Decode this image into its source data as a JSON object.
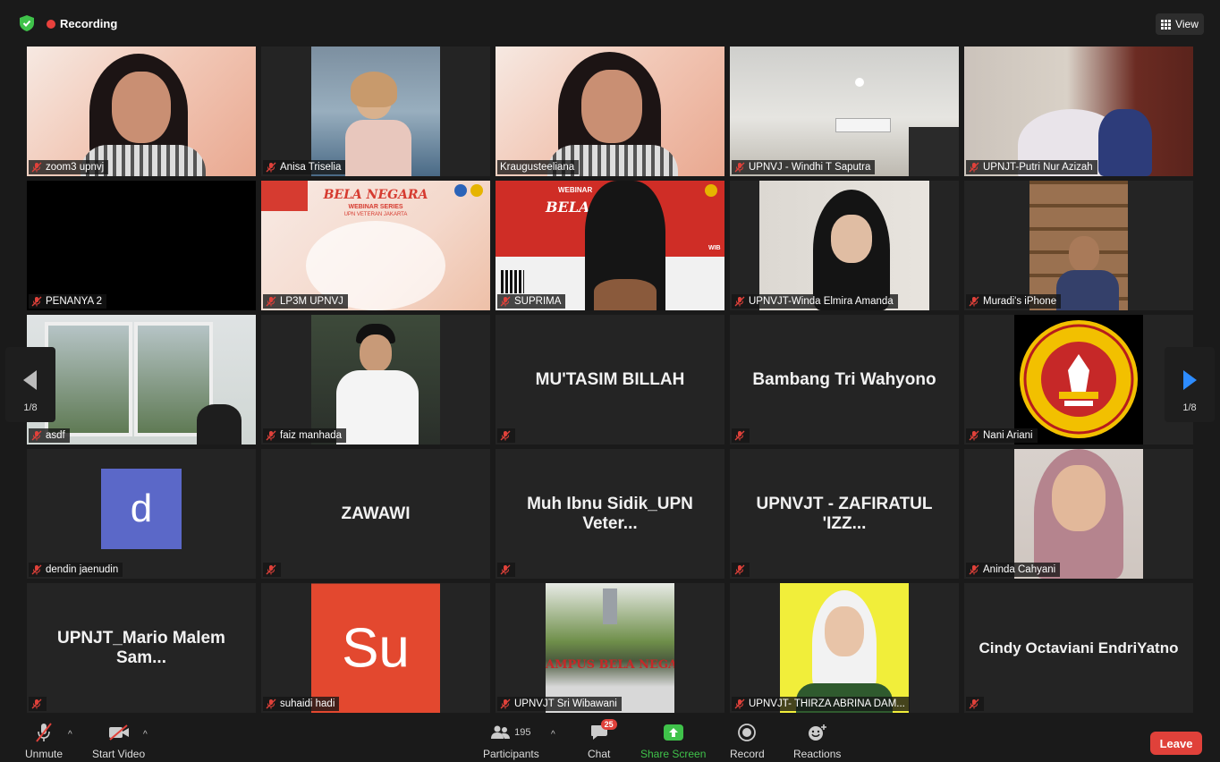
{
  "recording_label": "Recording",
  "view_label": "View",
  "page_indicator": {
    "left": "1/8",
    "right": "1/8"
  },
  "tiles": [
    {
      "name": "zoom3 upnvj"
    },
    {
      "name": "Anisa Triselia"
    },
    {
      "name": "Kraugusteeliana"
    },
    {
      "name": "UPNVJ - Windhi T Saputra"
    },
    {
      "name": "UPNJT-Putri Nur Azizah"
    },
    {
      "name": "PENANYA 2"
    },
    {
      "name": "LP3M UPNVJ",
      "slide_title": "BELA NEGARA",
      "slide_sub": "WEBINAR SERIES",
      "slide_sub2": "UPN VETERAN JAKARTA"
    },
    {
      "name": "SUPRIMA",
      "slide_title": "BELA",
      "slide_sub": "WEBINAR",
      "slide_time": "WIB"
    },
    {
      "name": "UPNVJT-Winda Elmira Amanda"
    },
    {
      "name": "Muradi's iPhone"
    },
    {
      "name": "asdf"
    },
    {
      "name": "faiz manhada"
    },
    {
      "big_name": "MU'TASIM BILLAH"
    },
    {
      "big_name": "Bambang Tri Wahyono"
    },
    {
      "name": "Nani Ariani",
      "logo_top": "UNIVERSITAS PEMBANGUNAN NASIONAL \"VETERAN\"",
      "logo_bottom": "JAKARTA"
    },
    {
      "name": "dendin jaenudin",
      "avatar_letter": "d"
    },
    {
      "big_name": "ZAWAWI"
    },
    {
      "big_name": "Muh Ibnu Sidik_UPN Veter..."
    },
    {
      "big_name": "UPNVJT - ZAFIRATUL 'IZZ..."
    },
    {
      "name": "Aninda Cahyani"
    },
    {
      "big_name": "UPNJT_Mario Malem Sam..."
    },
    {
      "name": "suhaidi hadi",
      "avatar_letter": "Su"
    },
    {
      "name": "UPNVJT Sri Wibawani",
      "banner": "AMPUS BELA NEGAR"
    },
    {
      "name": "UPNVJT- THIRZA ABRINA DAM..."
    },
    {
      "big_name": "Cindy Octaviani EndriYatno"
    }
  ],
  "toolbar": {
    "unmute": "Unmute",
    "start_video": "Start Video",
    "participants_label": "Participants",
    "participants_count": "195",
    "chat_label": "Chat",
    "chat_badge": "25",
    "share_label": "Share Screen",
    "record_label": "Record",
    "reactions_label": "Reactions",
    "leave_label": "Leave"
  },
  "colors": {
    "accent_green": "#3fc24a",
    "leave_red": "#e0413a",
    "recording_red": "#e8413c",
    "active_border": "#8fd16a"
  }
}
